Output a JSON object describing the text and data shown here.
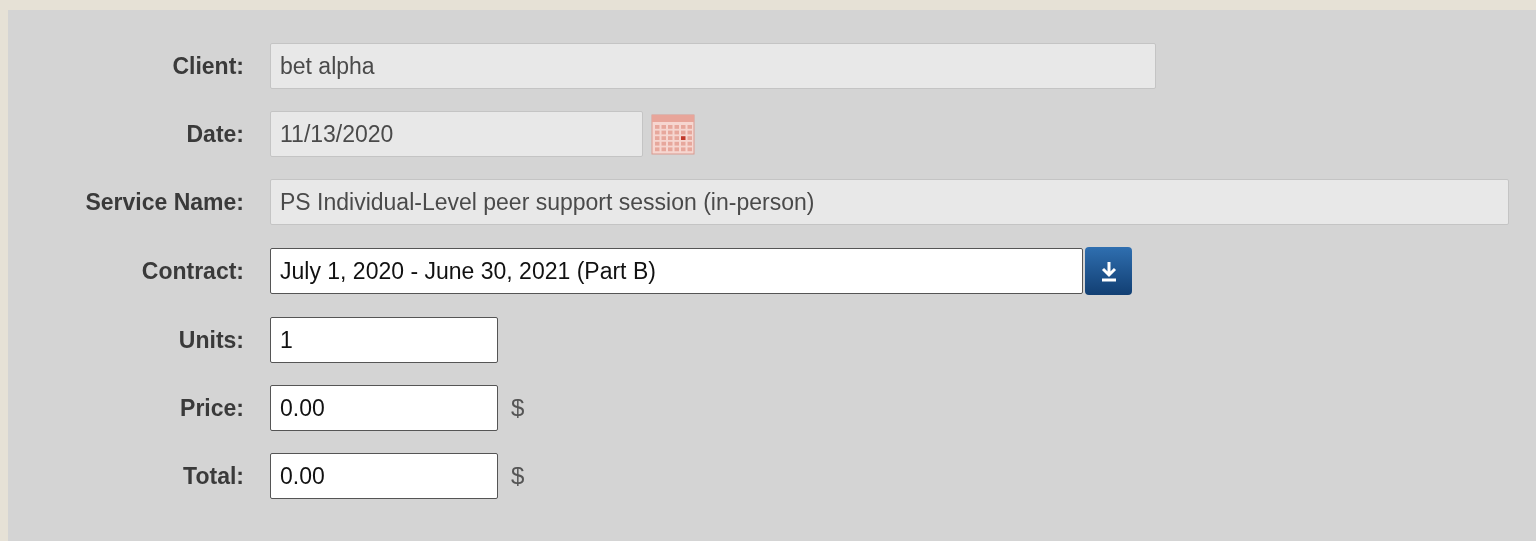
{
  "fields": [
    {
      "label": "Client:",
      "kind": "text",
      "value": "bet alpha",
      "disabled": true
    },
    {
      "label": "Date:",
      "kind": "date",
      "value": "11/13/2020",
      "disabled": true
    },
    {
      "label": "Service Name:",
      "kind": "text",
      "value": "PS Individual-Level peer support session (in-person)",
      "disabled": true
    },
    {
      "label": "Contract:",
      "kind": "select",
      "value": "July 1, 2020 - June 30, 2021 (Part B)",
      "disabled": false
    },
    {
      "label": "Units:",
      "kind": "text",
      "value": "1",
      "disabled": false
    },
    {
      "label": "Price:",
      "kind": "text",
      "value": "0.00",
      "disabled": false,
      "suffix": "$"
    },
    {
      "label": "Total:",
      "kind": "text",
      "value": "0.00",
      "disabled": false,
      "suffix": "$"
    }
  ]
}
